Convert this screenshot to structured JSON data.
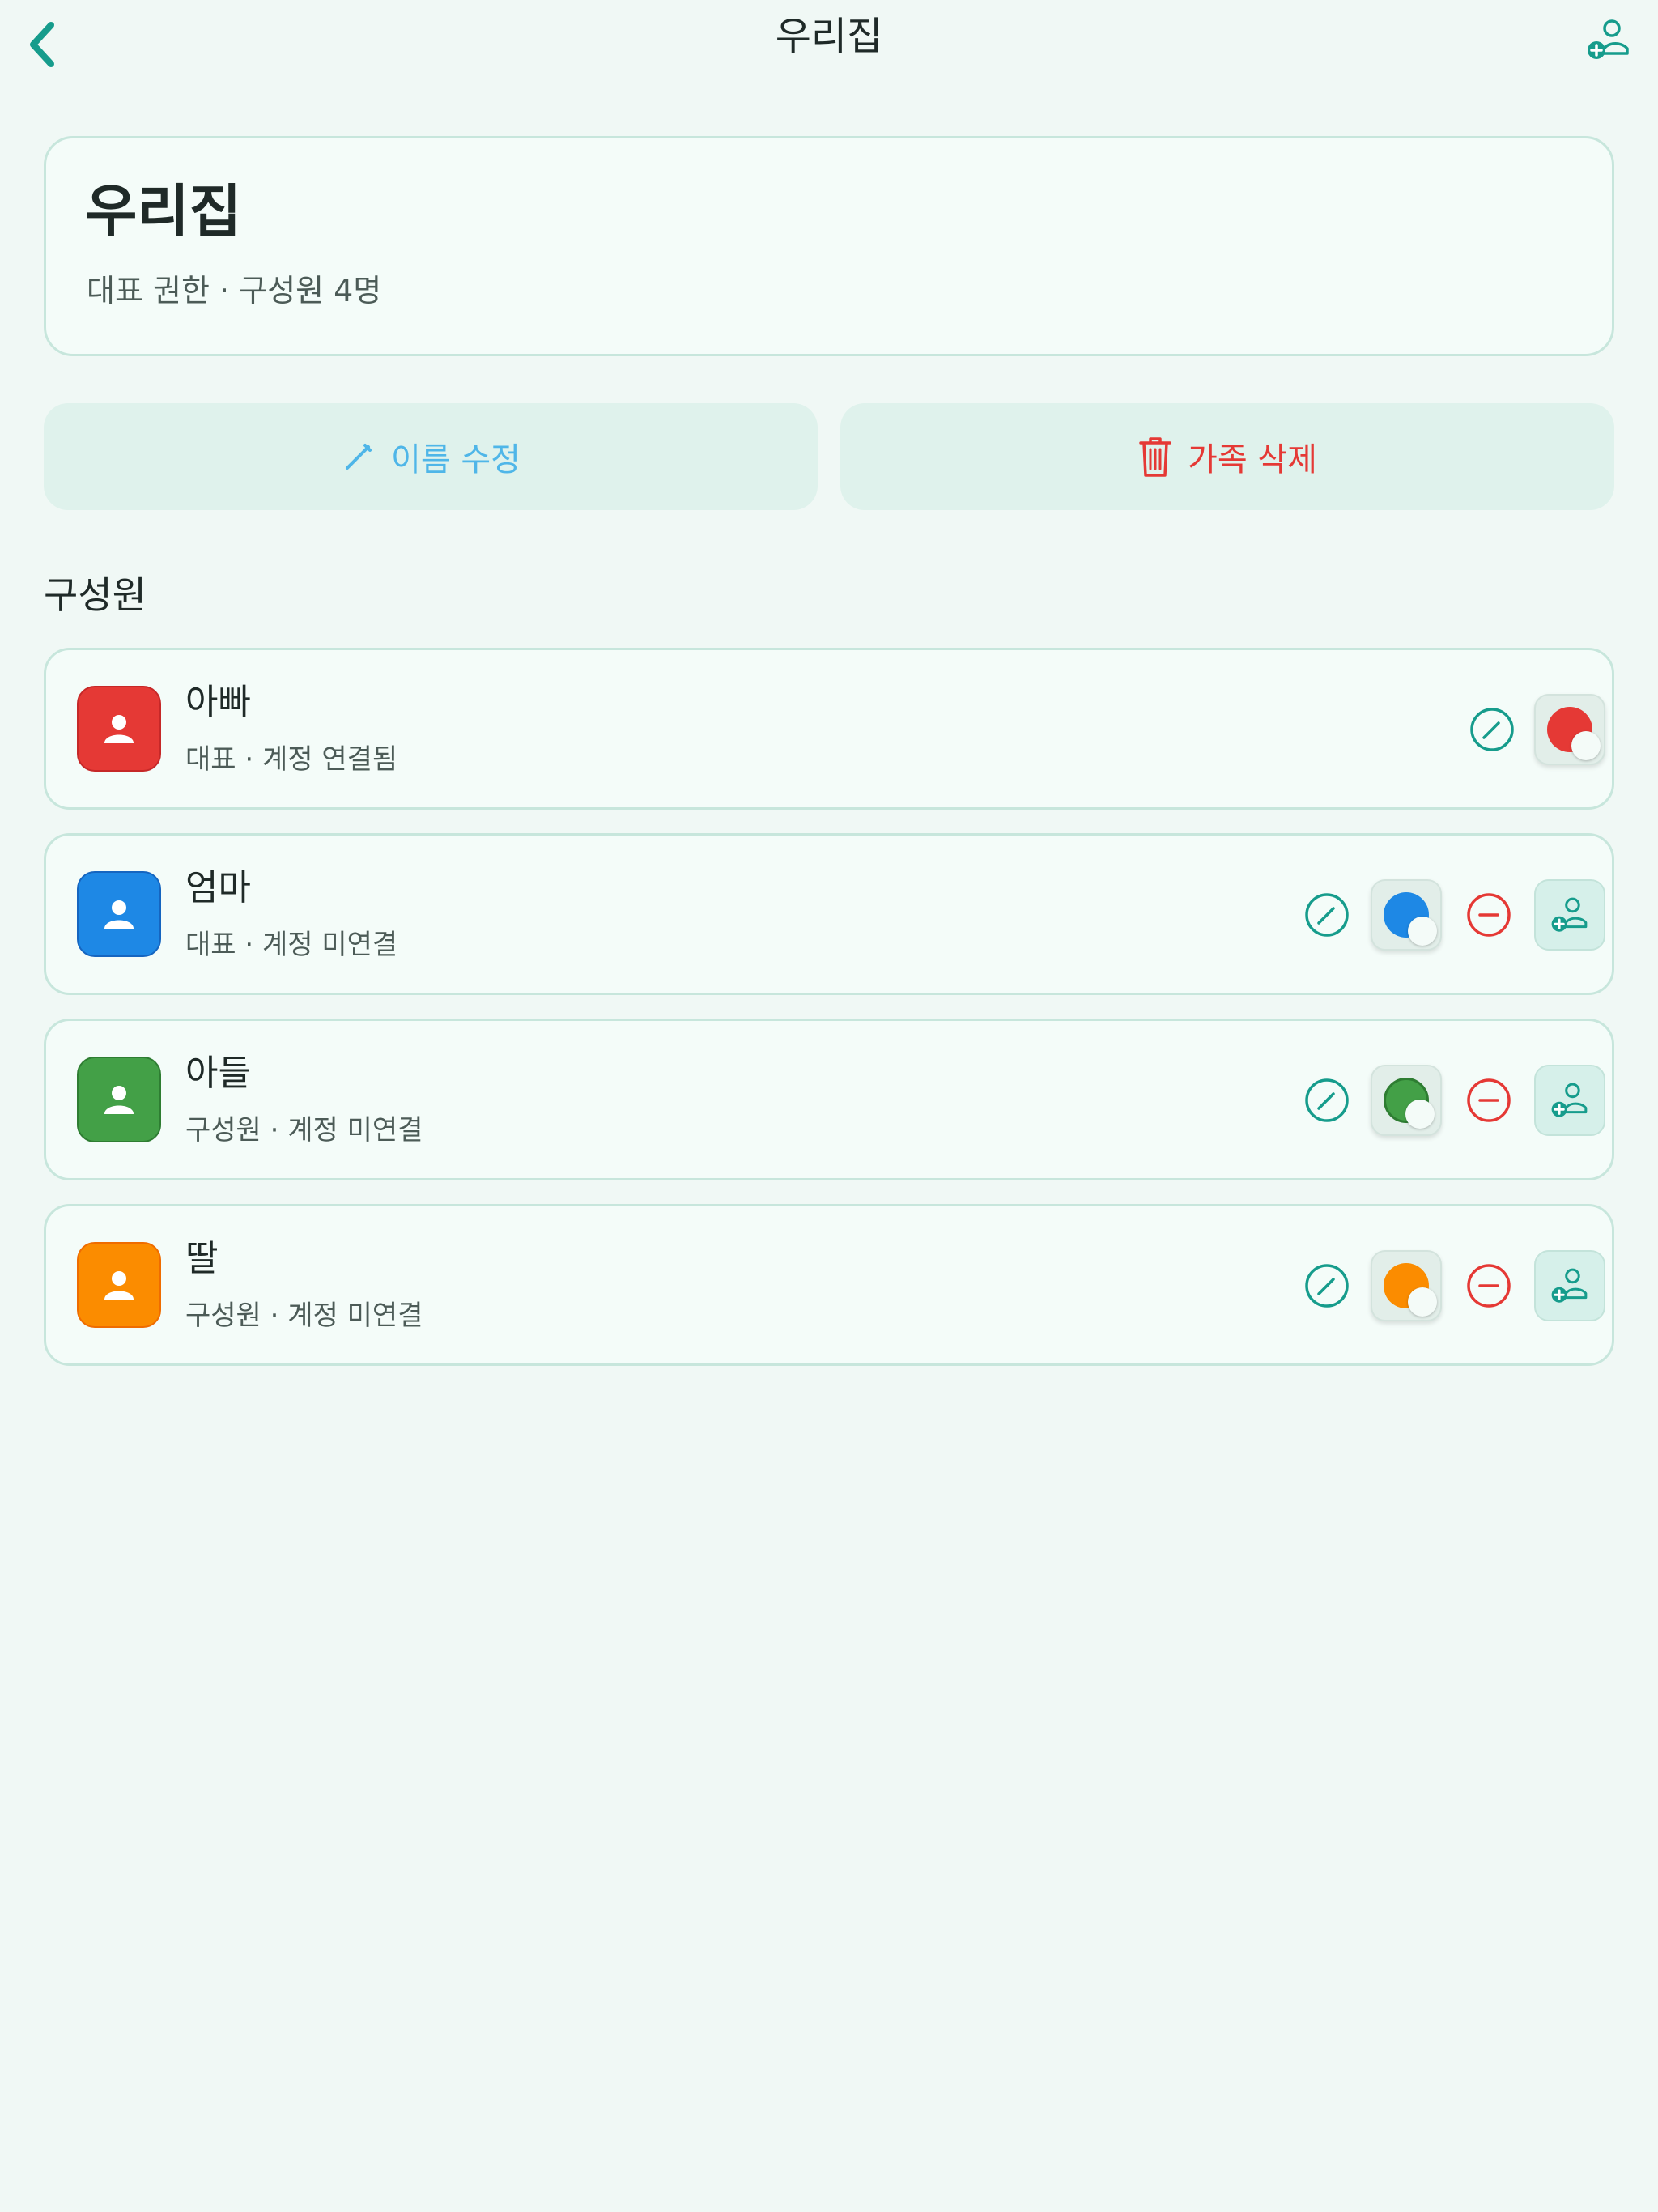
{
  "nav": {
    "title": "우리집"
  },
  "family": {
    "name": "우리집",
    "subtitle": "대표 권한 · 구성원 4명"
  },
  "actions": {
    "rename_label": "이름 수정",
    "delete_label": "가족 삭제"
  },
  "section": {
    "members_title": "구성원"
  },
  "members": [
    {
      "name": "아빠",
      "subtitle": "대표 · 계정 연결됨",
      "color": "#e53935",
      "linked": true
    },
    {
      "name": "엄마",
      "subtitle": "대표 · 계정 미연결",
      "color": "#1e88e5",
      "linked": false
    },
    {
      "name": "아들",
      "subtitle": "구성원 · 계정 미연결",
      "color": "#43a047",
      "linked": false
    },
    {
      "name": "딸",
      "subtitle": "구성원 · 계정 미연결",
      "color": "#fb8c00",
      "linked": false
    }
  ],
  "colors": {
    "accent": "#169c8c",
    "danger": "#e53935",
    "rename": "#4fb6e8",
    "background": "#f0f8f5",
    "card_border": "#c7e6dc"
  },
  "icons": {
    "back": "chevron-left-icon",
    "add_member": "person-add-icon",
    "rename": "pencil-icon",
    "delete": "trash-icon",
    "edit": "edit-circle-icon",
    "remove": "minus-circle-icon",
    "avatar": "person-icon"
  }
}
